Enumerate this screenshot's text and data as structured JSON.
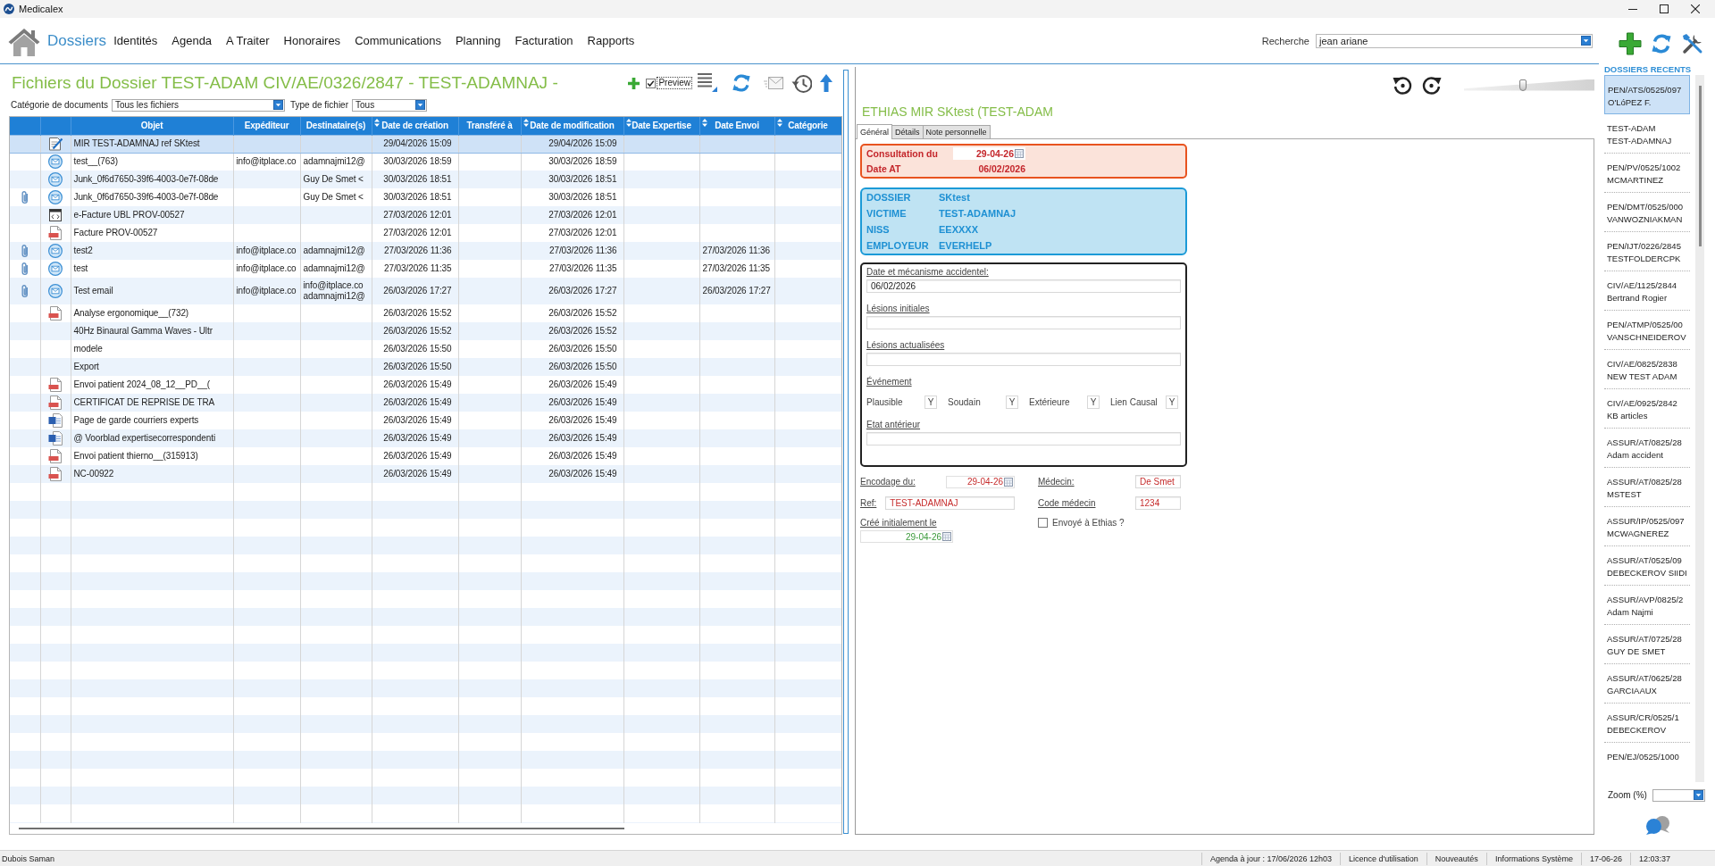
{
  "window": {
    "title": "Medicalex"
  },
  "menu": [
    {
      "label": "Dossiers",
      "selected": true
    },
    {
      "label": "Identités",
      "selected": false
    },
    {
      "label": "Agenda",
      "selected": false
    },
    {
      "label": "A Traiter",
      "selected": false
    },
    {
      "label": "Honoraires",
      "selected": false
    },
    {
      "label": "Communications",
      "selected": false
    },
    {
      "label": "Planning",
      "selected": false
    },
    {
      "label": "Facturation",
      "selected": false
    },
    {
      "label": "Rapports",
      "selected": false
    }
  ],
  "search": {
    "label": "Recherche",
    "value": "jean ariane"
  },
  "files_panel": {
    "title": "Fichiers du Dossier TEST-ADAM CIV/AE/0326/2847 - TEST-ADAMNAJ -",
    "preview": {
      "label": "Preview",
      "checked": true
    },
    "filters": [
      {
        "label": "Catégorie de documents",
        "value": "Tous les fichiers"
      },
      {
        "label": "Type de fichier",
        "value": "Tous"
      }
    ],
    "table": {
      "columns": [
        {
          "label": "Objet",
          "sortable": false
        },
        {
          "label": "Expéditeur",
          "sortable": false
        },
        {
          "label": "Destinataire(s)",
          "sortable": false
        },
        {
          "label": "Date de création",
          "sortable": true
        },
        {
          "label": "Transféré à",
          "sortable": false
        },
        {
          "label": "Date de modification",
          "sortable": true
        },
        {
          "label": "Date Expertise",
          "sortable": true
        },
        {
          "label": "Date Envoi",
          "sortable": true
        },
        {
          "label": "Catégorie",
          "sortable": true
        }
      ],
      "rows": [
        {
          "kind": "document",
          "selected": true,
          "attachment": false,
          "object": "MIR TEST-ADAMNAJ ref SKtest",
          "created": "29/04/2026 15:09",
          "modified": "29/04/2026 15:09"
        },
        {
          "kind": "email",
          "selected": false,
          "attachment": false,
          "object": "test__(763)",
          "sender": "info@itplace.co",
          "recipients": [
            "adamnajmi12@"
          ],
          "created": "30/03/2026 18:59",
          "modified": "30/03/2026 18:59"
        },
        {
          "kind": "email",
          "selected": false,
          "attachment": false,
          "object": "Junk_0f6d7650-39f6-4003-0e7f-08de",
          "recipients": [
            "Guy De Smet <"
          ],
          "created": "30/03/2026 18:51",
          "modified": "30/03/2026 18:51"
        },
        {
          "kind": "email",
          "selected": false,
          "attachment": true,
          "object": "Junk_0f6d7650-39f6-4003-0e7f-08de",
          "recipients": [
            "Guy De Smet <"
          ],
          "created": "30/03/2026 18:51",
          "modified": "30/03/2026 18:51"
        },
        {
          "kind": "xml",
          "selected": false,
          "attachment": false,
          "object": "e-Facture UBL PROV-00527",
          "created": "27/03/2026 12:01",
          "modified": "27/03/2026 12:01"
        },
        {
          "kind": "pdf",
          "selected": false,
          "attachment": false,
          "object": "Facture PROV-00527",
          "created": "27/03/2026 12:01",
          "modified": "27/03/2026 12:01"
        },
        {
          "kind": "email",
          "selected": false,
          "attachment": true,
          "object": "test2",
          "sender": "info@itplace.co",
          "recipients": [
            "adamnajmi12@"
          ],
          "created": "27/03/2026 11:36",
          "modified": "27/03/2026 11:36",
          "sent": "27/03/2026 11:36"
        },
        {
          "kind": "email",
          "selected": false,
          "attachment": true,
          "object": "test",
          "sender": "info@itplace.co",
          "recipients": [
            "adamnajmi12@"
          ],
          "created": "27/03/2026 11:35",
          "modified": "27/03/2026 11:35",
          "sent": "27/03/2026 11:35"
        },
        {
          "kind": "email",
          "selected": false,
          "attachment": true,
          "object": "Test email",
          "sender": "info@itplace.co",
          "recipients": [
            "info@itplace.co",
            "adamnajmi12@"
          ],
          "created": "26/03/2026 17:27",
          "modified": "26/03/2026 17:27",
          "sent": "26/03/2026 17:27"
        },
        {
          "kind": "pdf",
          "selected": false,
          "attachment": false,
          "object": "Analyse ergonomique__(732)",
          "created": "26/03/2026 15:52",
          "modified": "26/03/2026 15:52"
        },
        {
          "kind": "plain",
          "selected": false,
          "attachment": false,
          "object": "40Hz Binaural Gamma Waves - Ultr",
          "created": "26/03/2026 15:52",
          "modified": "26/03/2026 15:52"
        },
        {
          "kind": "plain",
          "selected": false,
          "attachment": false,
          "object": "modele",
          "created": "26/03/2026 15:50",
          "modified": "26/03/2026 15:50"
        },
        {
          "kind": "plain",
          "selected": false,
          "attachment": false,
          "object": "Export",
          "created": "26/03/2026 15:50",
          "modified": "26/03/2026 15:50"
        },
        {
          "kind": "pdf",
          "selected": false,
          "attachment": false,
          "object": "Envoi patient 2024_08_12__PD__(",
          "created": "26/03/2026 15:49",
          "modified": "26/03/2026 15:49"
        },
        {
          "kind": "pdf",
          "selected": false,
          "attachment": false,
          "object": "CERTIFICAT DE REPRISE DE TRA",
          "created": "26/03/2026 15:49",
          "modified": "26/03/2026 15:49"
        },
        {
          "kind": "word",
          "selected": false,
          "attachment": false,
          "object": "Page de garde courriers experts",
          "created": "26/03/2026 15:49",
          "modified": "26/03/2026 15:49"
        },
        {
          "kind": "word",
          "selected": false,
          "attachment": false,
          "object": "@ Voorblad expertisecorrespondenti",
          "created": "26/03/2026 15:49",
          "modified": "26/03/2026 15:49"
        },
        {
          "kind": "pdf",
          "selected": false,
          "attachment": false,
          "object": "Envoi patient thierno__(315913)",
          "created": "26/03/2026 15:49",
          "modified": "26/03/2026 15:49"
        },
        {
          "kind": "pdf",
          "selected": false,
          "attachment": false,
          "object": "NC-00922",
          "created": "26/03/2026 15:49",
          "modified": "26/03/2026 15:49"
        }
      ]
    }
  },
  "dossier_panel": {
    "zoom_slider": {
      "level": 0.45
    },
    "title": "ETHIAS MIR SKtest (TEST-ADAM",
    "tabs": [
      {
        "label": "Général",
        "selected": true
      },
      {
        "label": "Détails",
        "selected": false
      },
      {
        "label": "Note personnelle",
        "selected": false
      }
    ],
    "consultation": [
      {
        "kind": "date_field",
        "label": "Consultation du",
        "value": "29-04-26"
      },
      {
        "kind": "text",
        "label": "Date AT",
        "value": "06/02/2026"
      }
    ],
    "case_info": [
      {
        "label": "DOSSIER",
        "value": "SKtest"
      },
      {
        "label": "VICTIME",
        "value": "TEST-ADAMNAJ"
      },
      {
        "label": "NISS",
        "value": "EEXXXX"
      },
      {
        "label": "EMPLOYEUR",
        "value": "EVERHELP"
      }
    ],
    "accident_sections": [
      {
        "kind": "text_field",
        "label": "Date et mécanisme accidentel:",
        "value": "06/02/2026"
      },
      {
        "kind": "text_field",
        "label": "Lésions initiales"
      },
      {
        "kind": "text_field",
        "label": "Lésions actualisées"
      },
      {
        "kind": "criteria",
        "label": "Événement",
        "items": [
          {
            "label": "Plausible",
            "value": "Y"
          },
          {
            "label": "Soudain",
            "value": "Y"
          },
          {
            "label": "Extérieure",
            "value": "Y"
          },
          {
            "label": "Lien Causal",
            "value": "Y"
          }
        ]
      },
      {
        "kind": "text_field",
        "label": "Etat antérieur"
      }
    ],
    "record_fields": [
      {
        "kind": "date",
        "label": "Encodage du:",
        "value": "29-04-26",
        "color": "#c62d2d"
      },
      {
        "kind": "text",
        "label": "Médecin:",
        "value": "De Smet",
        "color": "#c62d2d"
      },
      {
        "kind": "text",
        "label": "Ref:",
        "value": "TEST-ADAMNAJ",
        "color": "#c62d2d"
      },
      {
        "kind": "text",
        "label": "Code médecin",
        "value": "1234",
        "color": "#c62d2d"
      },
      {
        "kind": "date_stacked",
        "label": "Créé initialement le",
        "value": "29-04-26",
        "color": "#3c9a3c"
      },
      {
        "kind": "checkbox",
        "label": "Envoyé à Ethias ?",
        "checked": false
      }
    ]
  },
  "recent_dossiers": {
    "title": "DOSSIERS RECENTS",
    "items": [
      {
        "code": "PEN/ATS/0525/097",
        "name": "O'LóPEZ F.",
        "selected": true
      },
      {
        "code": "TEST-ADAM",
        "name": "TEST-ADAMNAJ",
        "selected": false
      },
      {
        "code": "PEN/PV/0525/1002",
        "name": "MCMARTINEZ",
        "selected": false
      },
      {
        "code": "PEN/DMT/0525/000",
        "name": "VANWOZNIAKMAN",
        "selected": false
      },
      {
        "code": "PEN/IJT/0226/2845",
        "name": "TESTFOLDERCPK",
        "selected": false
      },
      {
        "code": "CIV/AE/1125/2844",
        "name": "Bertrand Rogier",
        "selected": false
      },
      {
        "code": "PEN/ATMP/0525/00",
        "name": "VANSCHNEIDEROV",
        "selected": false
      },
      {
        "code": "CIV/AE/0825/2838",
        "name": "NEW TEST ADAM",
        "selected": false
      },
      {
        "code": "CIV/AE/0925/2842",
        "name": "KB articles",
        "selected": false
      },
      {
        "code": "ASSUR/AT/0825/28",
        "name": "Adam accident",
        "selected": false
      },
      {
        "code": "ASSUR/AT/0825/28",
        "name": "MSTEST",
        "selected": false
      },
      {
        "code": "ASSUR/IP/0525/097",
        "name": "MCWAGNEREZ",
        "selected": false
      },
      {
        "code": "ASSUR/AT/0525/09",
        "name": "DEBECKEROV SIIDI",
        "selected": false
      },
      {
        "code": "ASSUR/AVP/0825/2",
        "name": "Adam Najmi",
        "selected": false
      },
      {
        "code": "ASSUR/AT/0725/28",
        "name": "GUY DE SMET",
        "selected": false
      },
      {
        "code": "ASSUR/AT/0625/28",
        "name": "GARCIAAUX",
        "selected": false
      },
      {
        "code": "ASSUR/CR/0525/1",
        "name": "DEBECKEROV",
        "selected": false
      },
      {
        "code": "PEN/EJ/0525/1000",
        "selected": false
      }
    ],
    "zoom_label": "Zoom (%)"
  },
  "status_bar": {
    "user": "Dubois Saman",
    "items": [
      "Agenda à jour : 17/06/2026 12h03",
      "Licence d'utilisation",
      "Nouveautés",
      "Informations Système",
      "17-06-26",
      "12:03:37"
    ]
  }
}
